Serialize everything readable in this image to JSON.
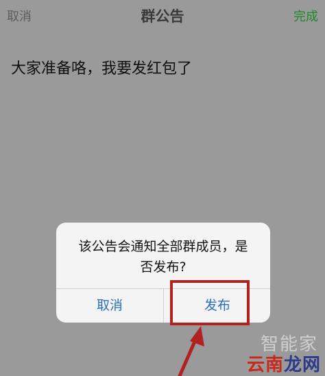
{
  "navbar": {
    "cancel_label": "取消",
    "title": "群公告",
    "done_label": "完成"
  },
  "announcement_text": "大家准备咯，我要发红包了",
  "dialog": {
    "message_line1": "该公告会通知全部群成员，是",
    "message_line2": "否发布?",
    "cancel_label": "取消",
    "publish_label": "发布"
  },
  "watermark": {
    "top": "智能家",
    "bottom_part1": "云南",
    "bottom_part2": "龙网"
  },
  "colors": {
    "overlay_bg": "#9a9a9a",
    "done_green": "#1d8a2a",
    "dialog_button_blue": "#2b6fb8",
    "highlight_red": "#b0211f"
  }
}
